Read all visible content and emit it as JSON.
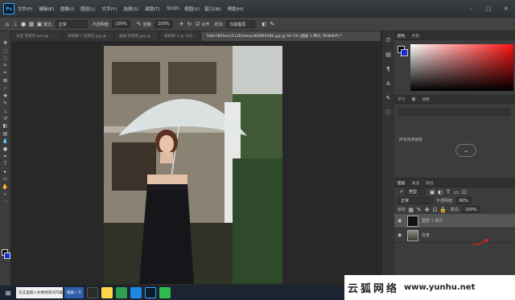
{
  "menubar": {
    "app_icon": "Ps",
    "items": [
      "文件(F)",
      "编辑(E)",
      "图像(I)",
      "图层(L)",
      "文字(Y)",
      "选择(S)",
      "滤镜(T)",
      "3D(D)",
      "视图(V)",
      "窗口(W)",
      "帮助(H)"
    ]
  },
  "options": {
    "mode_label": "模式:",
    "mode_value": "正常",
    "opacity_label": "不透明度:",
    "opacity_value": "100%",
    "flow_label": "流量:",
    "flow_value": "100%",
    "align_label": "对齐",
    "sample_label": "样本:",
    "sample_value": "当前图层"
  },
  "tabs": [
    {
      "label": "天空 欣赏的.psd @ ..."
    },
    {
      "label": "未标题-1 欣赏的.jpg @ ..."
    },
    {
      "label": "通道 欣赏的.jpg @ ..."
    },
    {
      "label": "未标题-1 @ 100..."
    },
    {
      "label": "7d0e7805ae151283ebea360899189.jpg @ 50.1% (图层 1 拷贝, RGB/8#) *",
      "active": true
    }
  ],
  "panels": {
    "color_tabs": [
      "颜色",
      "色板"
    ],
    "library_tabs": [
      "学习",
      "库",
      "调整"
    ],
    "library_text": "所有资源链接",
    "layer_tabs": [
      "图层",
      "通道",
      "路径"
    ],
    "kind_filter": "类型",
    "blend_mode": "正常",
    "opacity_label": "不透明度:",
    "opacity_value": "60%",
    "lock_label": "锁定:",
    "fill_label": "填充:",
    "fill_value": "100%",
    "layers": [
      {
        "name": "图层 1 拷贝",
        "selected": true
      },
      {
        "name": "背景",
        "selected": false
      }
    ]
  },
  "taskbar": {
    "search_text": "在这里输入你要搜索的内容",
    "button_label": "搜索一下",
    "time": "2021/11/19"
  },
  "watermark": {
    "cn": "云狐网络",
    "url": "www.yunhu.net"
  },
  "colors": {
    "background_swatch": "#1a2cd6",
    "accent": "#31a8ff"
  }
}
